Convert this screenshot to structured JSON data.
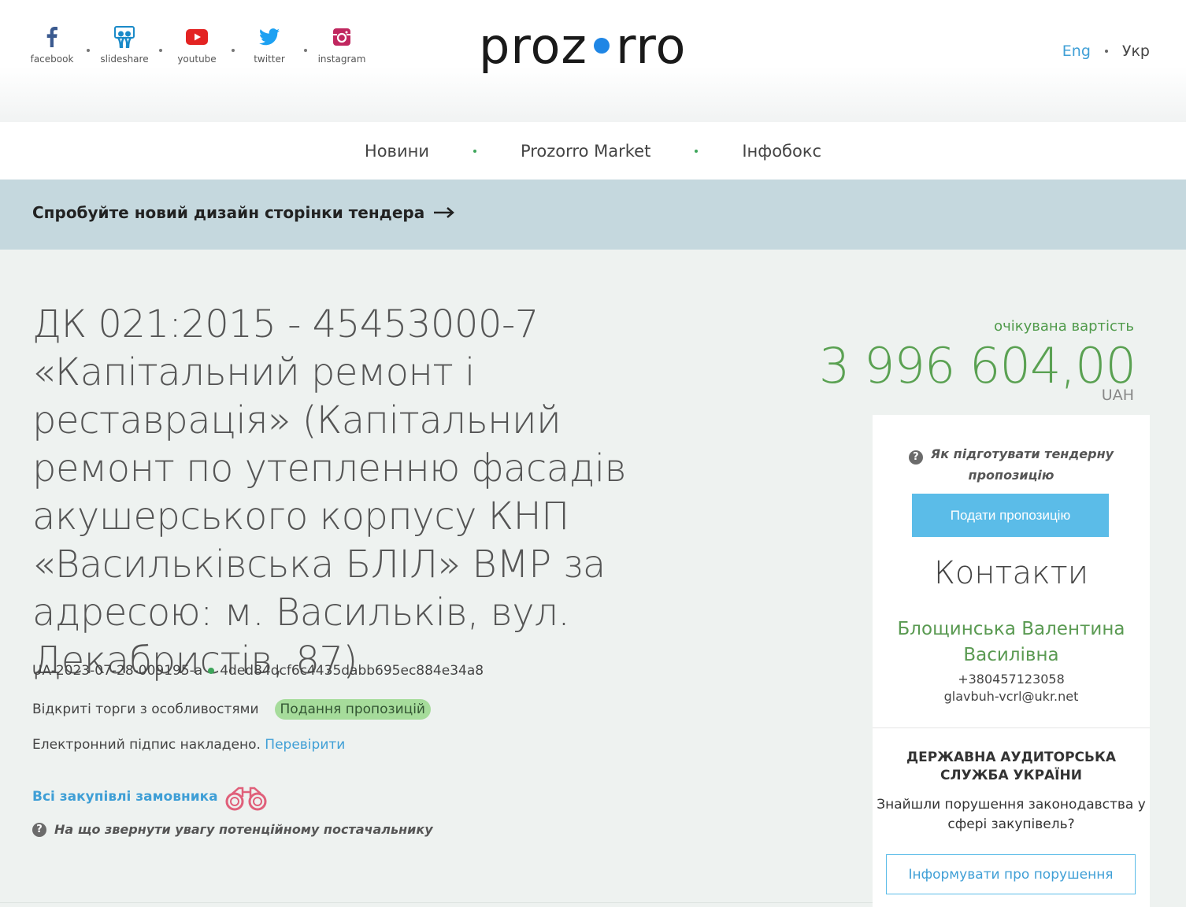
{
  "header": {
    "social": [
      {
        "label": "facebook",
        "icon": "facebook-icon"
      },
      {
        "label": "slideshare",
        "icon": "slideshare-icon"
      },
      {
        "label": "youtube",
        "icon": "youtube-icon"
      },
      {
        "label": "twitter",
        "icon": "twitter-icon"
      },
      {
        "label": "instagram",
        "icon": "instagram-icon"
      }
    ],
    "logo_left": "proz",
    "logo_right": "rro",
    "lang_eng": "Eng",
    "lang_ukr": "Укр"
  },
  "nav": {
    "items": [
      "Новини",
      "Prozorro Market",
      "Інфобокс"
    ]
  },
  "banner": {
    "text": "Спробуйте новий дизайн сторінки тендера"
  },
  "tender": {
    "title": "ДК 021:2015 - 45453000-7 «Капітальний ремонт і реставрація» (Капітальний ремонт по утепленню фасадів акушерського корпусу КНП «Васильківська БЛІЛ» ВМР за адресою: м. Васильків, вул. Декабристів, 87)",
    "id": "UA-2023-07-28-009195-a",
    "hash": "4ded84dcf6c4435dabb695ec884e34a8",
    "procedure": "Відкриті торги з особливостями",
    "status": "Подання пропозицій",
    "signature_text": "Електронний підпис накладено.",
    "signature_check": "Перевірити",
    "all_purchases": "Всі закупівлі замовника",
    "attention": "На що звернути увагу потенційному постачальнику"
  },
  "value": {
    "label": "очікувана вартість",
    "amount": "3 996 604,00",
    "currency": "UAH"
  },
  "sidebar": {
    "howto": "Як підготувати тендерну пропозицію",
    "submit": "Подати пропозицію",
    "contacts_title": "Контакти",
    "contact_name": "Блощинська Валентина Василівна",
    "contact_phone": "+380457123058",
    "contact_email": "glavbuh-vcrl@ukr.net",
    "audit_title": "ДЕРЖАВНА АУДИТОРСЬКА СЛУЖБА УКРАЇНИ",
    "audit_text": "Знайшли порушення законодавства у сфері закупівель?",
    "report": "Інформувати про порушення"
  },
  "colors": {
    "accent_blue": "#5bbce8",
    "link_blue": "#3f9fd6",
    "value_green": "#5aa152",
    "status_green": "#a6dc9b",
    "banner_bg": "#c5d8de",
    "page_bg": "#eef2f0"
  }
}
